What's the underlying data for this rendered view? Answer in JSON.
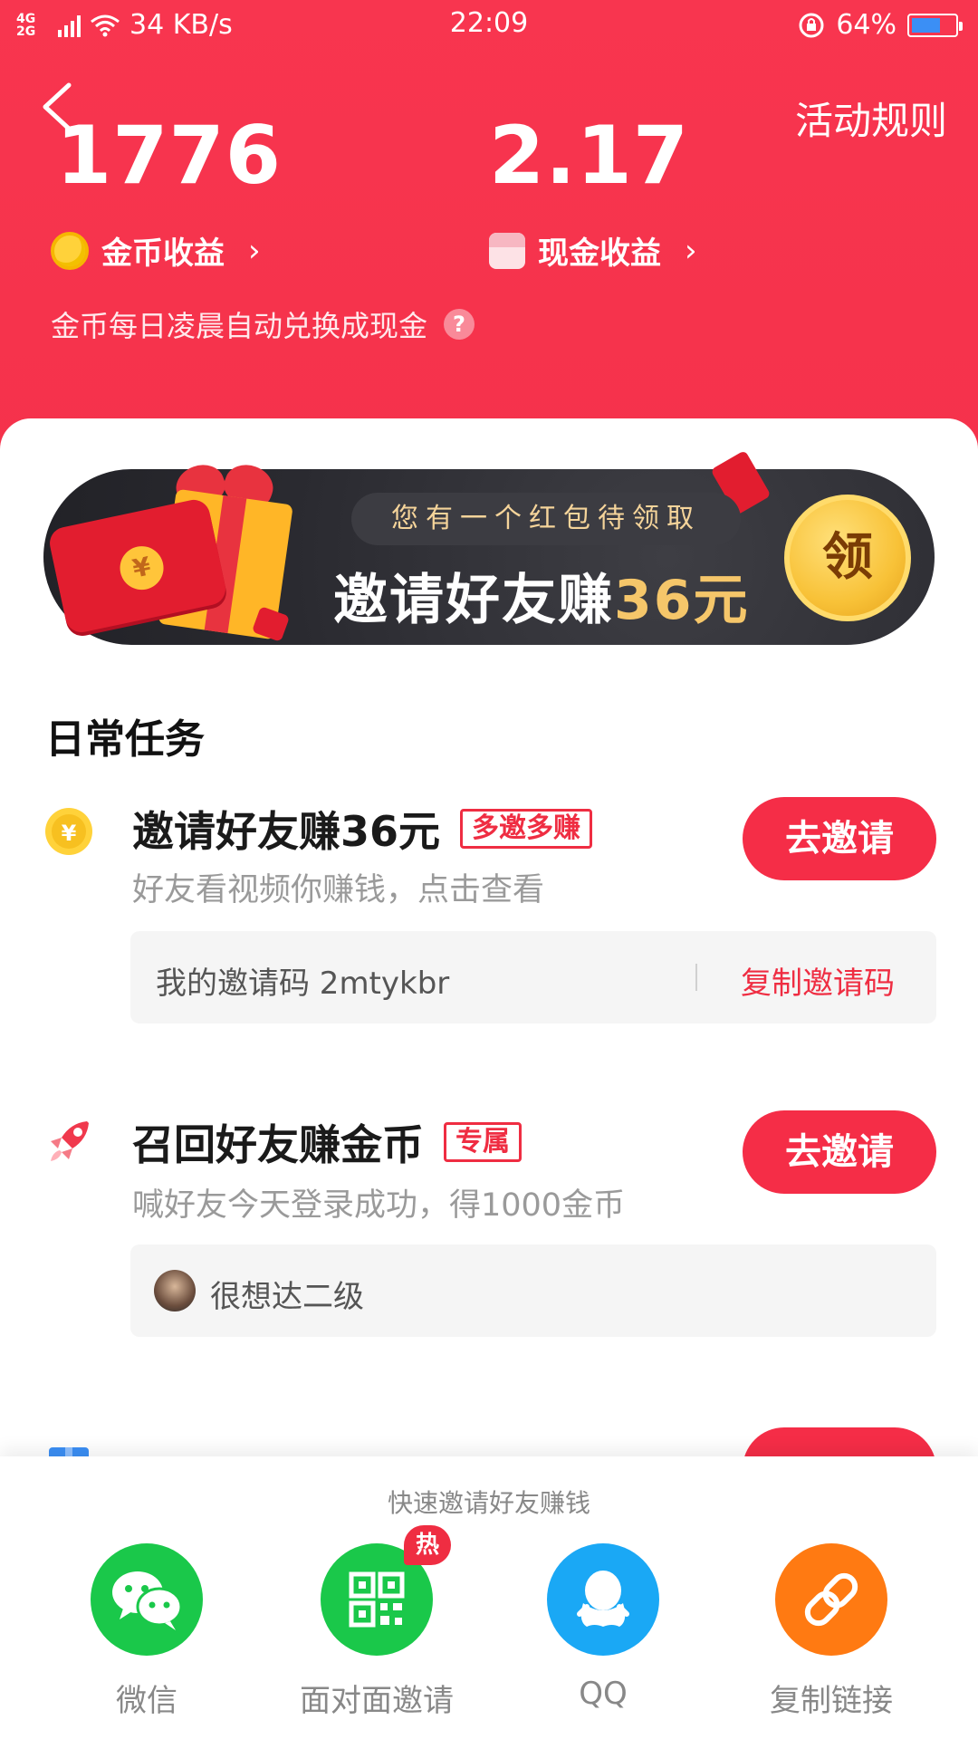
{
  "status_bar": {
    "network": "4G 2G",
    "speed": "34 KB/s",
    "time": "22:09",
    "battery": "64%"
  },
  "header": {
    "rules_label": "活动规则",
    "coins_value": "1776",
    "coins_label": "金币收益",
    "cash_value": "2.17",
    "cash_label": "现金收益",
    "exchange_note": "金币每日凌晨自动兑换成现金",
    "help_glyph": "?"
  },
  "banner": {
    "pill_text": "您有一个红包待领取",
    "title_prefix": "邀请好友赚",
    "title_amount": "36元",
    "claim_label": "领",
    "yen_glyph": "¥"
  },
  "daily_tasks": {
    "section_title": "日常任务",
    "tasks": [
      {
        "title": "邀请好友赚36元",
        "tag": "多邀多赚",
        "subtitle": "好友看视频你赚钱，点击查看",
        "button": "去邀请",
        "code_label": "我的邀请码 2mtykbr",
        "copy_label": "复制邀请码"
      },
      {
        "title": "召回好友赚金币",
        "tag": "专属",
        "subtitle": "喊好友今天登录成功，得1000金币",
        "button": "去邀请",
        "friend_name": "很想达二级"
      }
    ]
  },
  "share_sheet": {
    "title": "快速邀请好友赚钱",
    "items": [
      {
        "label": "微信",
        "color": "#1ac84a",
        "icon": "wechat-icon"
      },
      {
        "label": "面对面邀请",
        "color": "#1ac84a",
        "icon": "qr-code-icon",
        "badge": "热"
      },
      {
        "label": "QQ",
        "color": "#1aa8f5",
        "icon": "qq-icon"
      },
      {
        "label": "复制链接",
        "color": "#ff7a12",
        "icon": "link-icon"
      }
    ]
  },
  "colors": {
    "primary_red": "#f52d47",
    "header_red": "#f8354f",
    "gold": "#f5c66a"
  }
}
